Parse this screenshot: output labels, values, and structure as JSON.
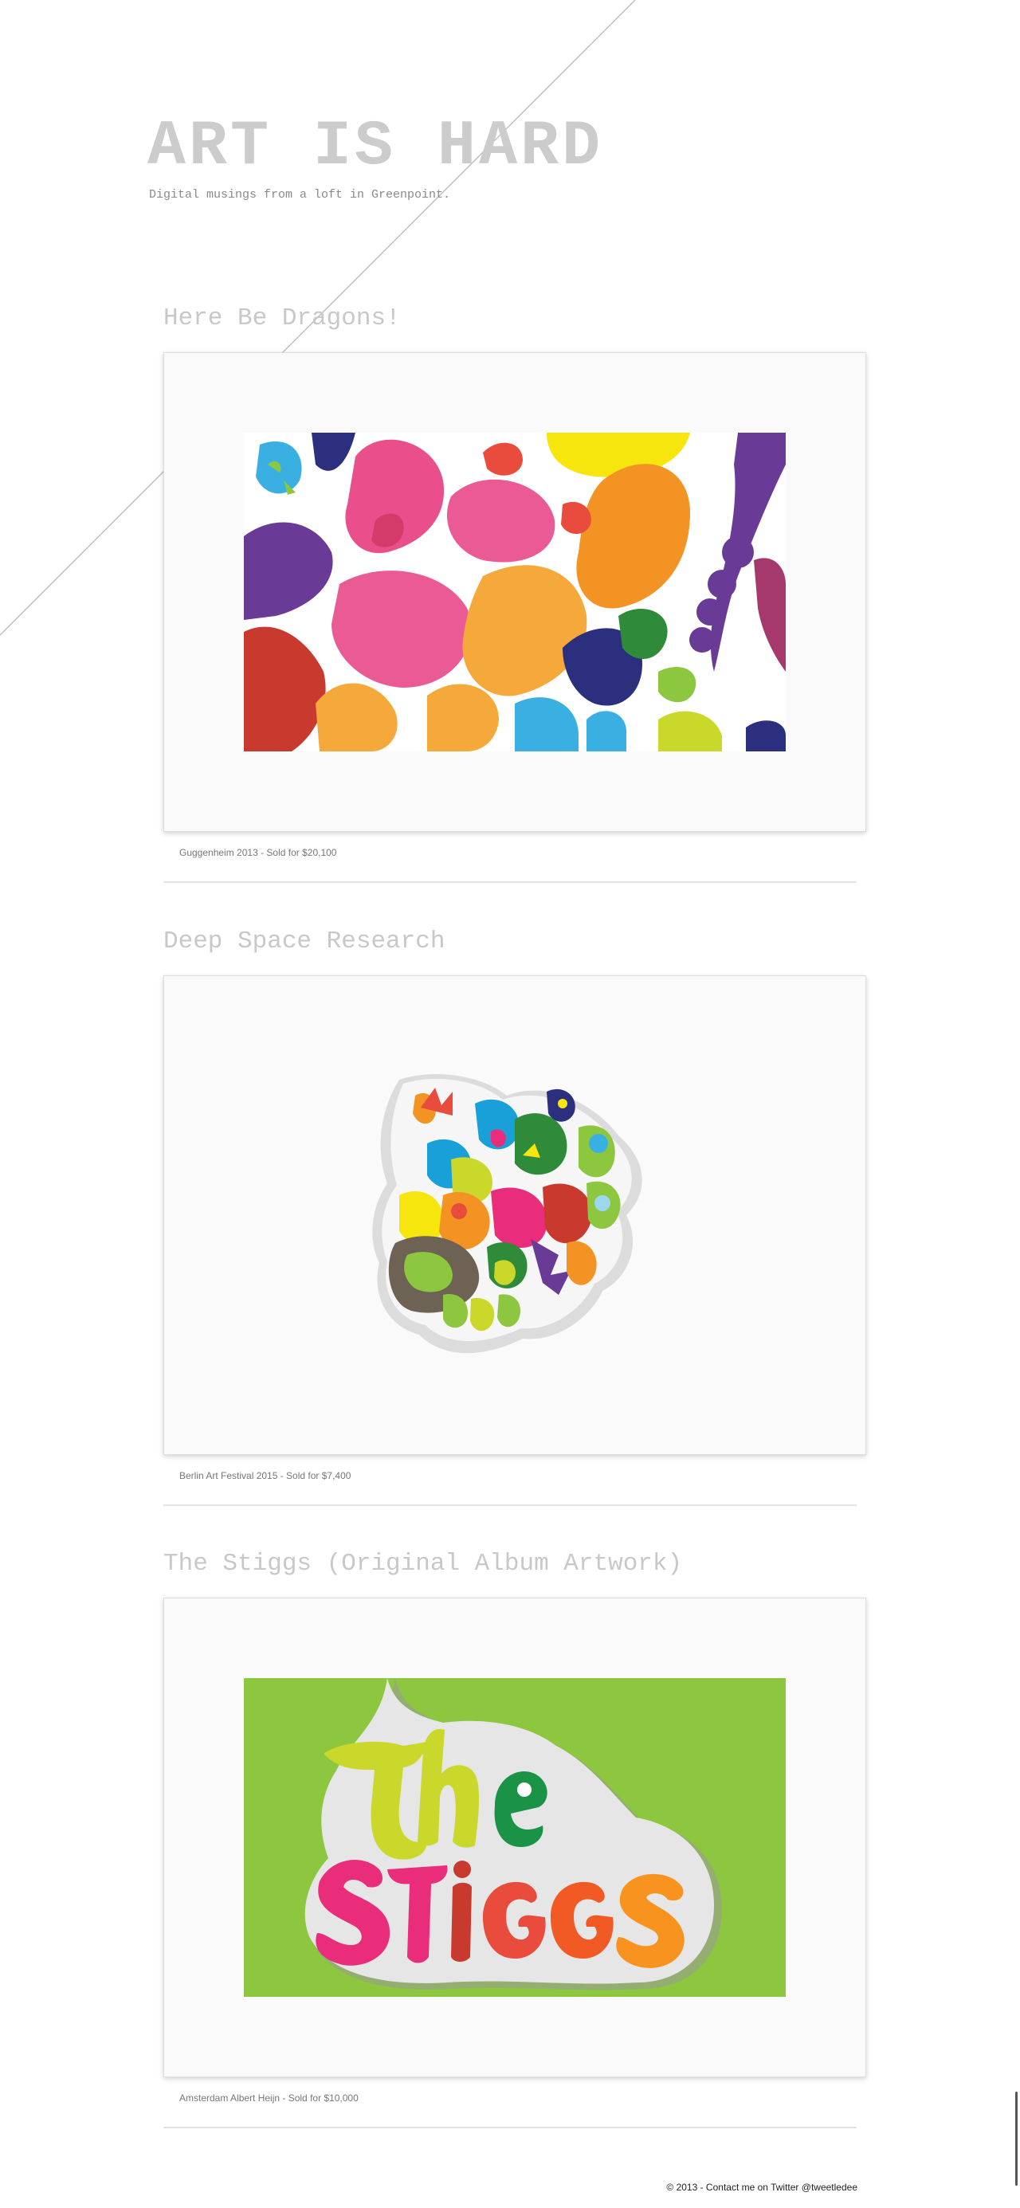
{
  "site": {
    "title": "ART IS HARD",
    "tagline": "Digital musings from a loft in Greenpoint."
  },
  "posts": [
    {
      "title": "Here Be Dragons!",
      "caption": "Guggenheim 2013 - Sold for $20,100",
      "artwork": "abstract-colorful-blobs-artwork"
    },
    {
      "title": "Deep Space Research",
      "caption": "Berlin Art Festival 2015 - Sold for $7,400",
      "artwork": "doodle-sticker-cluster-artwork"
    },
    {
      "title": "The Stiggs (Original Album Artwork)",
      "caption": "Amsterdam Albert Heijn - Sold for $10,000",
      "artwork": "the-stiggs-lettering-artwork"
    }
  ],
  "footer": {
    "text": "© 2013 - Contact me on Twitter",
    "twitter_handle": "@tweetledee"
  },
  "colors": {
    "title": "#cccccc",
    "frame_background": "#fafafa",
    "divider": "#e3e3e3",
    "stiggs_background": "#8dc63f"
  }
}
